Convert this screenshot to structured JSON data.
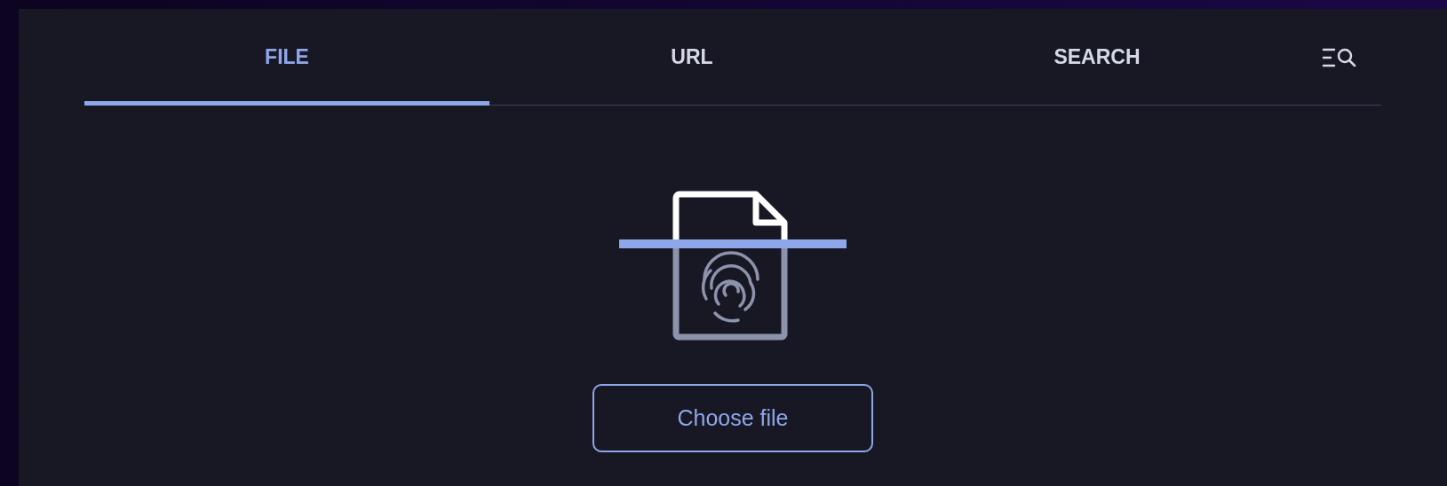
{
  "tabs": [
    {
      "label": "FILE",
      "selected": true
    },
    {
      "label": "URL",
      "selected": false
    },
    {
      "label": "SEARCH",
      "selected": false
    }
  ],
  "search_tab": {
    "selected": false
  },
  "upload": {
    "button": "Choose file"
  }
}
